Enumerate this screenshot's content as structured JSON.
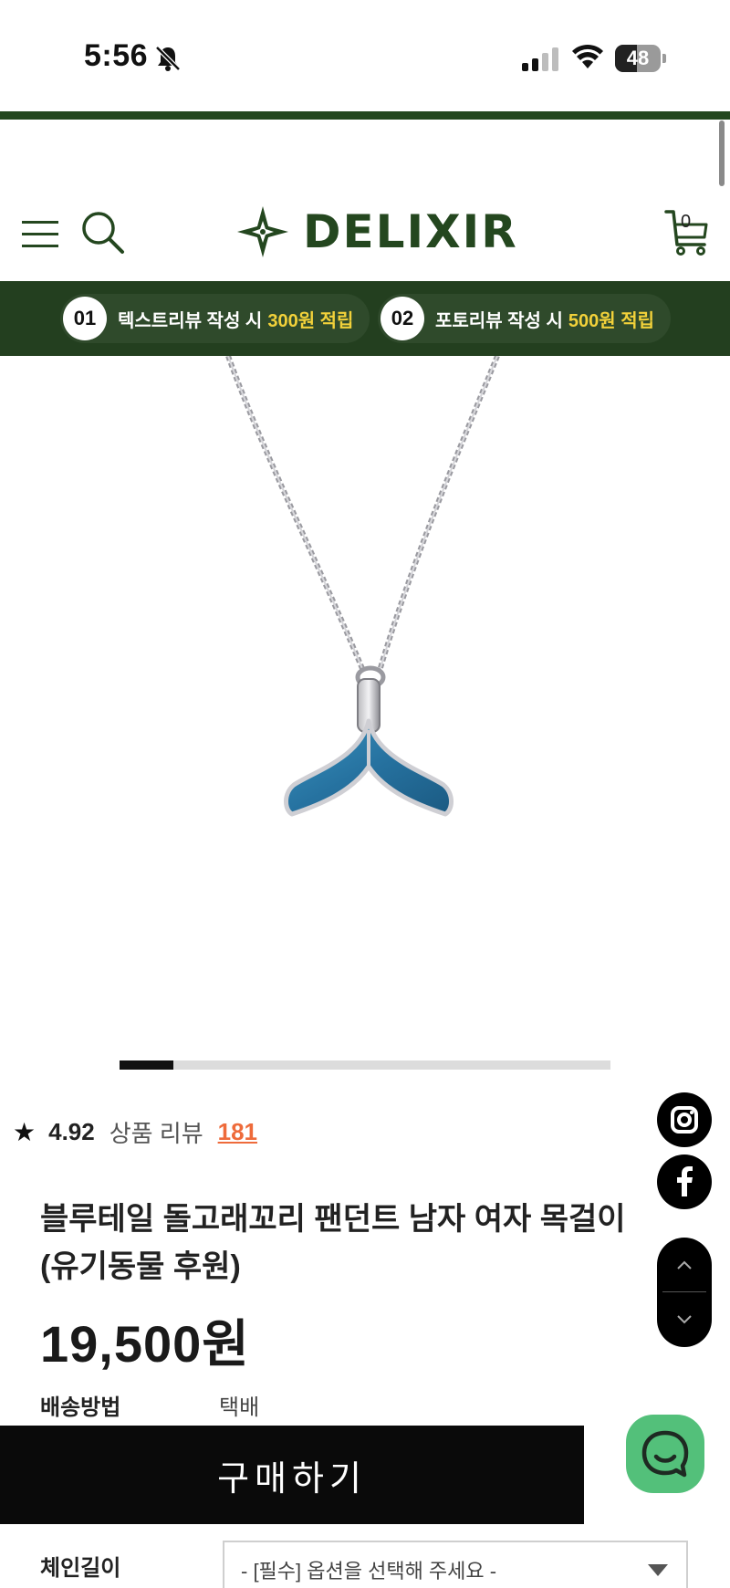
{
  "status_bar": {
    "time": "5:56",
    "battery": "48",
    "battery_level": 0.48
  },
  "header": {
    "logo_text": "DELIXIR",
    "cart_count": "0"
  },
  "promo": {
    "items": [
      {
        "num": "01",
        "text": "텍스트리뷰 작성 시",
        "highlight": "300원 적립"
      },
      {
        "num": "02",
        "text": "포토리뷰 작성 시",
        "highlight": "500원 적립"
      }
    ]
  },
  "gallery": {
    "progress": 0.11
  },
  "rating": {
    "score": "4.92",
    "review_label": "상품 리뷰",
    "review_count": "181"
  },
  "product": {
    "title": "블루테일 돌고래꼬리 팬던트 남자 여자 목걸이 (유기동물 후원)",
    "price": "19,500원",
    "shipping_label": "배송방법",
    "shipping_value": "택배"
  },
  "buy_button": "구매하기",
  "options": {
    "chain_label": "체인길이",
    "chain_placeholder": "- [필수] 옵션을 선택해 주세요 -"
  },
  "colors": {
    "brand_green": "#24471f",
    "banner_green": "#233f1f",
    "highlight_yellow": "#f2d13a",
    "review_orange": "#ee6b3b",
    "chat_green": "#53c07a"
  },
  "icons": [
    "bell-slash-icon",
    "signal-icon",
    "wifi-icon",
    "menu-icon",
    "search-icon",
    "cart-icon",
    "star-icon",
    "instagram-icon",
    "facebook-icon",
    "chevron-up-icon",
    "chevron-down-icon",
    "chat-icon"
  ]
}
